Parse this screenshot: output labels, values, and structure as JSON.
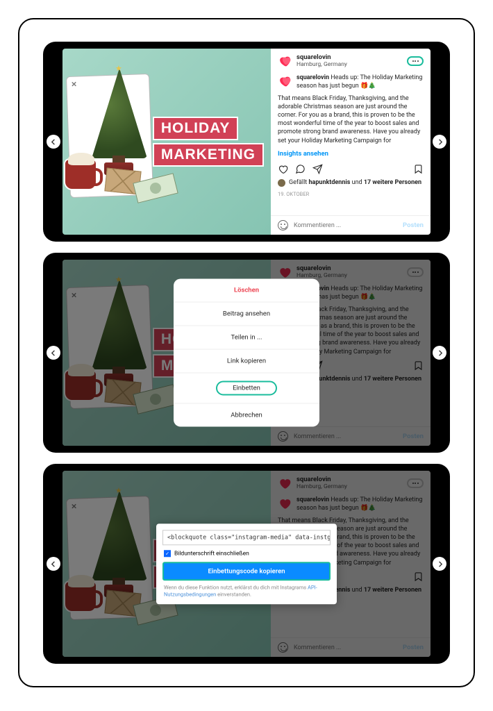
{
  "img": {
    "title1": "HOLIDAY",
    "title2": "MARKETING"
  },
  "post": {
    "username": "squarelovin",
    "location": "Hamburg, Germany",
    "caption_lead": "Heads up: The Holiday Marketing season has just begun 🎁🎄",
    "body": "That means Black Friday, Thanksgiving, and the adorable Christmas season are just around the corner. For you as a brand, this is proven to be the most wonderful time of the year to boost sales and promote strong brand awareness. Have you already set your Holiday Marketing Campaign for",
    "insights": "Insights ansehen",
    "likes_prefix": "Gefällt ",
    "likes_user": "hapunktdennis",
    "likes_and": " und ",
    "likes_count": "17 weitere Personen",
    "date": "19. OKTOBER",
    "comment_ph": "Kommentieren ...",
    "post_btn": "Posten"
  },
  "menu": {
    "delete": "Löschen",
    "view": "Beitrag ansehen",
    "share": "Teilen in ...",
    "copylink": "Link kopieren",
    "embed": "Einbetten",
    "cancel": "Abbrechen"
  },
  "embed": {
    "code": "<blockquote class=\"instagram-media\" data-instgrm-cap",
    "include": "Bildunterschrift einschließen",
    "button": "Einbettungscode kopieren",
    "terms_pre": "Wenn du diese Funktion nutzt, erklärst du dich mit Instagrams ",
    "terms_link": "API-Nutzungsbedingungen",
    "terms_post": " einverstanden."
  }
}
